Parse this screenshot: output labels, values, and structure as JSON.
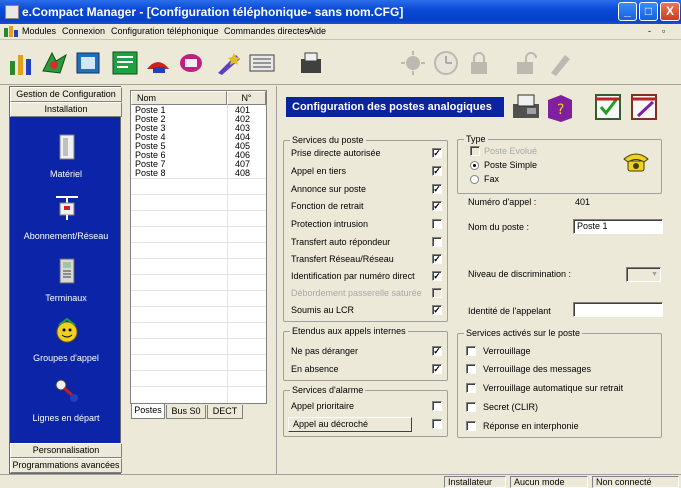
{
  "window": {
    "title": "e.Compact Manager - [Configuration téléphonique- sans nom.CFG]",
    "controls": {
      "minimize": "_",
      "maximize": "□",
      "close": "X"
    }
  },
  "menu": {
    "items": [
      "Modules",
      "Connexion",
      "Configuration téléphonique",
      "Commandes directes",
      "Aide"
    ],
    "doc_controls": {
      "minimize": "-",
      "restore": "▫"
    }
  },
  "toolbar": {
    "icons": [
      "network-icon",
      "modules-icon",
      "catalog-icon",
      "config-icon",
      "phone-edit-icon",
      "phone-book-icon",
      "wizard-icon",
      "keyboard-icon",
      "fax-icon",
      "sun-icon",
      "clock-icon",
      "lock-icon",
      "lock-open-icon",
      "pen-icon"
    ]
  },
  "nav": {
    "top_button": "Gestion de Configuration",
    "section_button": "Installation",
    "items": [
      {
        "label": "Matériel",
        "icon": "hardware-icon"
      },
      {
        "label": "Abonnement/Réseau",
        "icon": "network-plug-icon"
      },
      {
        "label": "Terminaux",
        "icon": "terminal-phone-icon"
      },
      {
        "label": "Groupes d'appel",
        "icon": "group-smiley-icon"
      },
      {
        "label": "Lignes en départ",
        "icon": "outgoing-line-icon"
      }
    ],
    "bottom_buttons": [
      "Personnalisation",
      "Programmations avancées"
    ]
  },
  "list": {
    "columns": [
      "Nom",
      "N°"
    ],
    "rows": [
      [
        "Poste 1",
        "401"
      ],
      [
        "Poste 2",
        "402"
      ],
      [
        "Poste 3",
        "403"
      ],
      [
        "Poste 4",
        "404"
      ],
      [
        "Poste 5",
        "405"
      ],
      [
        "Poste 6",
        "406"
      ],
      [
        "Poste 7",
        "407"
      ],
      [
        "Poste 8",
        "408"
      ]
    ],
    "tabs": [
      "Postes",
      "Bus S0",
      "DECT"
    ]
  },
  "main": {
    "banner": "Configuration des postes analogiques",
    "services": {
      "legend": "Services du poste",
      "items": [
        {
          "label": "Prise directe autorisée",
          "checked": true,
          "disabled": false
        },
        {
          "label": "Appel en tiers",
          "checked": true,
          "disabled": false
        },
        {
          "label": "Annonce sur poste",
          "checked": true,
          "disabled": false
        },
        {
          "label": "Fonction de retrait",
          "checked": true,
          "disabled": false
        },
        {
          "label": "Protection intrusion",
          "checked": false,
          "disabled": false
        },
        {
          "label": "Transfert auto répondeur",
          "checked": false,
          "disabled": false
        },
        {
          "label": "Transfert Réseau/Réseau",
          "checked": true,
          "disabled": false
        },
        {
          "label": "Identification par numéro direct",
          "checked": true,
          "disabled": false
        },
        {
          "label": "Débordement passerelle saturée",
          "checked": false,
          "disabled": true
        },
        {
          "label": "Soumis au LCR",
          "checked": true,
          "disabled": false
        }
      ]
    },
    "internal": {
      "legend": "Etendus aux appels internes",
      "items": [
        {
          "label": "Ne pas déranger",
          "checked": true
        },
        {
          "label": "En absence",
          "checked": true
        }
      ]
    },
    "alarm": {
      "legend": "Services d'alarme",
      "items": [
        {
          "label": "Appel prioritaire",
          "checked": false
        },
        {
          "label": "Appel au décroché",
          "checked": false
        }
      ]
    },
    "type": {
      "legend": "Type",
      "evolved_label": "Poste Evolué",
      "options": [
        {
          "label": "Poste Simple",
          "selected": true
        },
        {
          "label": "Fax",
          "selected": false
        }
      ]
    },
    "numero_label": "Numéro d'appel :",
    "numero_value": "401",
    "nom_label": "Nom du poste :",
    "nom_value": "Poste 1",
    "discrimination_label": "Niveau de discrimination :",
    "discrimination_value": "",
    "identite_label": "Identité de l'appelant",
    "identite_value": "",
    "activated": {
      "legend": "Services activés sur le poste",
      "items": [
        {
          "label": "Verrouillage",
          "checked": false
        },
        {
          "label": "Verrouillage des messages",
          "checked": false
        },
        {
          "label": "Verrouillage automatique sur retrait",
          "checked": false
        },
        {
          "label": "Secret  (CLIR)",
          "checked": false
        },
        {
          "label": "Réponse en interphonie",
          "checked": false
        }
      ]
    }
  },
  "status": {
    "cells": [
      "Installateur",
      "Aucun mode",
      "Non connecté"
    ]
  },
  "colors": {
    "titlebar": "#0a49d6",
    "nav_bg": "#0c24a8",
    "banner_bg": "#0a24a0",
    "window_bg": "#ece9d8"
  }
}
